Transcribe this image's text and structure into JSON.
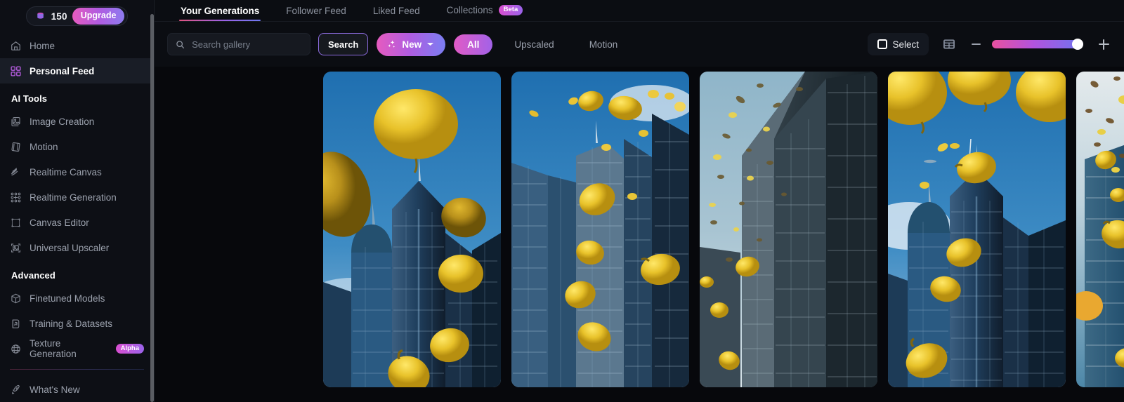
{
  "sidebar": {
    "credits": {
      "icon": "coins-icon",
      "value": "150",
      "upgrade_label": "Upgrade"
    },
    "items": [
      {
        "label": "Home",
        "icon": "home-icon",
        "active": false
      },
      {
        "label": "Personal Feed",
        "icon": "grid-squares-icon",
        "active": true
      }
    ],
    "sections": [
      {
        "title": "AI Tools",
        "items": [
          {
            "label": "Image Creation",
            "icon": "image-icon",
            "badge": ""
          },
          {
            "label": "Motion",
            "icon": "film-icon",
            "badge": ""
          },
          {
            "label": "Realtime Canvas",
            "icon": "brush-strokes-icon",
            "badge": ""
          },
          {
            "label": "Realtime Generation",
            "icon": "dotted-plus-icon",
            "badge": ""
          },
          {
            "label": "Canvas Editor",
            "icon": "frame-corners-icon",
            "badge": ""
          },
          {
            "label": "Universal Upscaler",
            "icon": "upscale-image-icon",
            "badge": ""
          }
        ]
      },
      {
        "title": "Advanced",
        "items": [
          {
            "label": "Finetuned Models",
            "icon": "cube-icon",
            "badge": ""
          },
          {
            "label": "Training & Datasets",
            "icon": "training-icon",
            "badge": ""
          },
          {
            "label": "Texture Generation",
            "icon": "texture-sphere-icon",
            "badge": "Alpha"
          }
        ]
      }
    ],
    "footer": {
      "label": "What's New",
      "icon": "rocket-icon"
    }
  },
  "tabs": [
    {
      "label": "Your Generations",
      "badge": "",
      "active": true
    },
    {
      "label": "Follower Feed",
      "badge": "",
      "active": false
    },
    {
      "label": "Liked Feed",
      "badge": "",
      "active": false
    },
    {
      "label": "Collections",
      "badge": "Beta",
      "active": false
    }
  ],
  "toolbar": {
    "search": {
      "icon": "search-icon",
      "placeholder": "Search gallery",
      "value": ""
    },
    "search_button": "Search",
    "new_button": {
      "label": "New",
      "icon": "sparkles-icon",
      "chevron": "chevron-down-icon"
    },
    "filters": [
      {
        "label": "All",
        "active": true
      },
      {
        "label": "Upscaled",
        "active": false
      },
      {
        "label": "Motion",
        "active": false
      }
    ],
    "select_button": {
      "label": "Select",
      "icon": "checkbox-square-icon"
    },
    "layout_button": {
      "icon": "layout-grid-icon"
    },
    "zoom_out": {
      "icon": "minus-icon"
    },
    "zoom_in": {
      "icon": "plus-icon"
    },
    "zoom_slider": {
      "value": 100,
      "min": 0,
      "max": 100
    }
  },
  "gallery": {
    "items": [
      {
        "alt": "Giant yellow lemons floating in blue sky above glass skyscrapers"
      },
      {
        "alt": "Many lemons falling between tall glass office towers"
      },
      {
        "alt": "Lemon fragments drifting past a dark angular glass skyscraper"
      },
      {
        "alt": "Oversized lemons hovering above twin blue glass towers"
      },
      {
        "alt": "Lemons and brown debris swirling around high-rise buildings"
      }
    ]
  },
  "colors": {
    "accent_pink": "#e65bbf",
    "accent_purple": "#a262e8",
    "accent_blue": "#6d74ef",
    "sidebar_bg": "#0d0f15",
    "main_bg": "#07080c",
    "active_nav_bg": "#191d26"
  }
}
